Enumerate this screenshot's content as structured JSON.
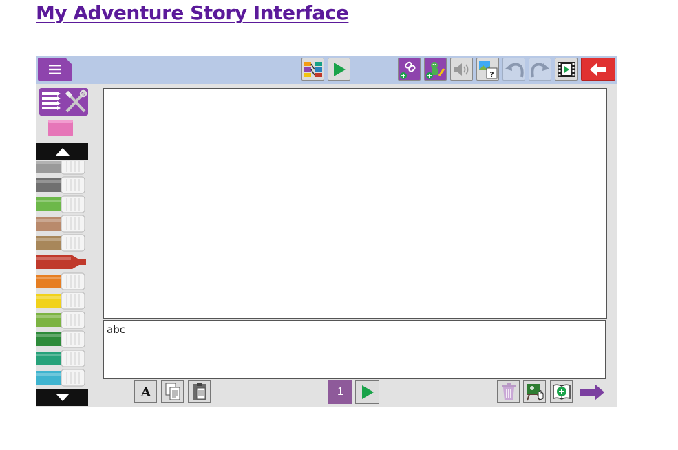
{
  "page": {
    "title": "My Adventure Story Interface"
  },
  "toolbar": {
    "menu_icon": "hamburger-icon",
    "buttons": [
      "storyboard-icon",
      "play-icon",
      "add-link-icon",
      "add-character-icon",
      "sound-icon",
      "image-quiz-icon",
      "undo-icon",
      "redo-icon",
      "movie-icon",
      "back-icon"
    ]
  },
  "sidebar": {
    "marker_colors": [
      "#9a9a9a",
      "#707070",
      "#6db84a",
      "#b98a6c",
      "#a8875a",
      "#c0392b",
      "#e67e22",
      "#f1d21b",
      "#7cb342",
      "#2e8b3a",
      "#27a27a",
      "#3fb4cf"
    ]
  },
  "textbox": {
    "value": "abc"
  },
  "bottom": {
    "page_number": "1"
  },
  "colors": {
    "accent": "#8e44ad",
    "toolbar_bg": "#b8c9e6",
    "title": "#5b1a9a",
    "back_red": "#e03131"
  }
}
